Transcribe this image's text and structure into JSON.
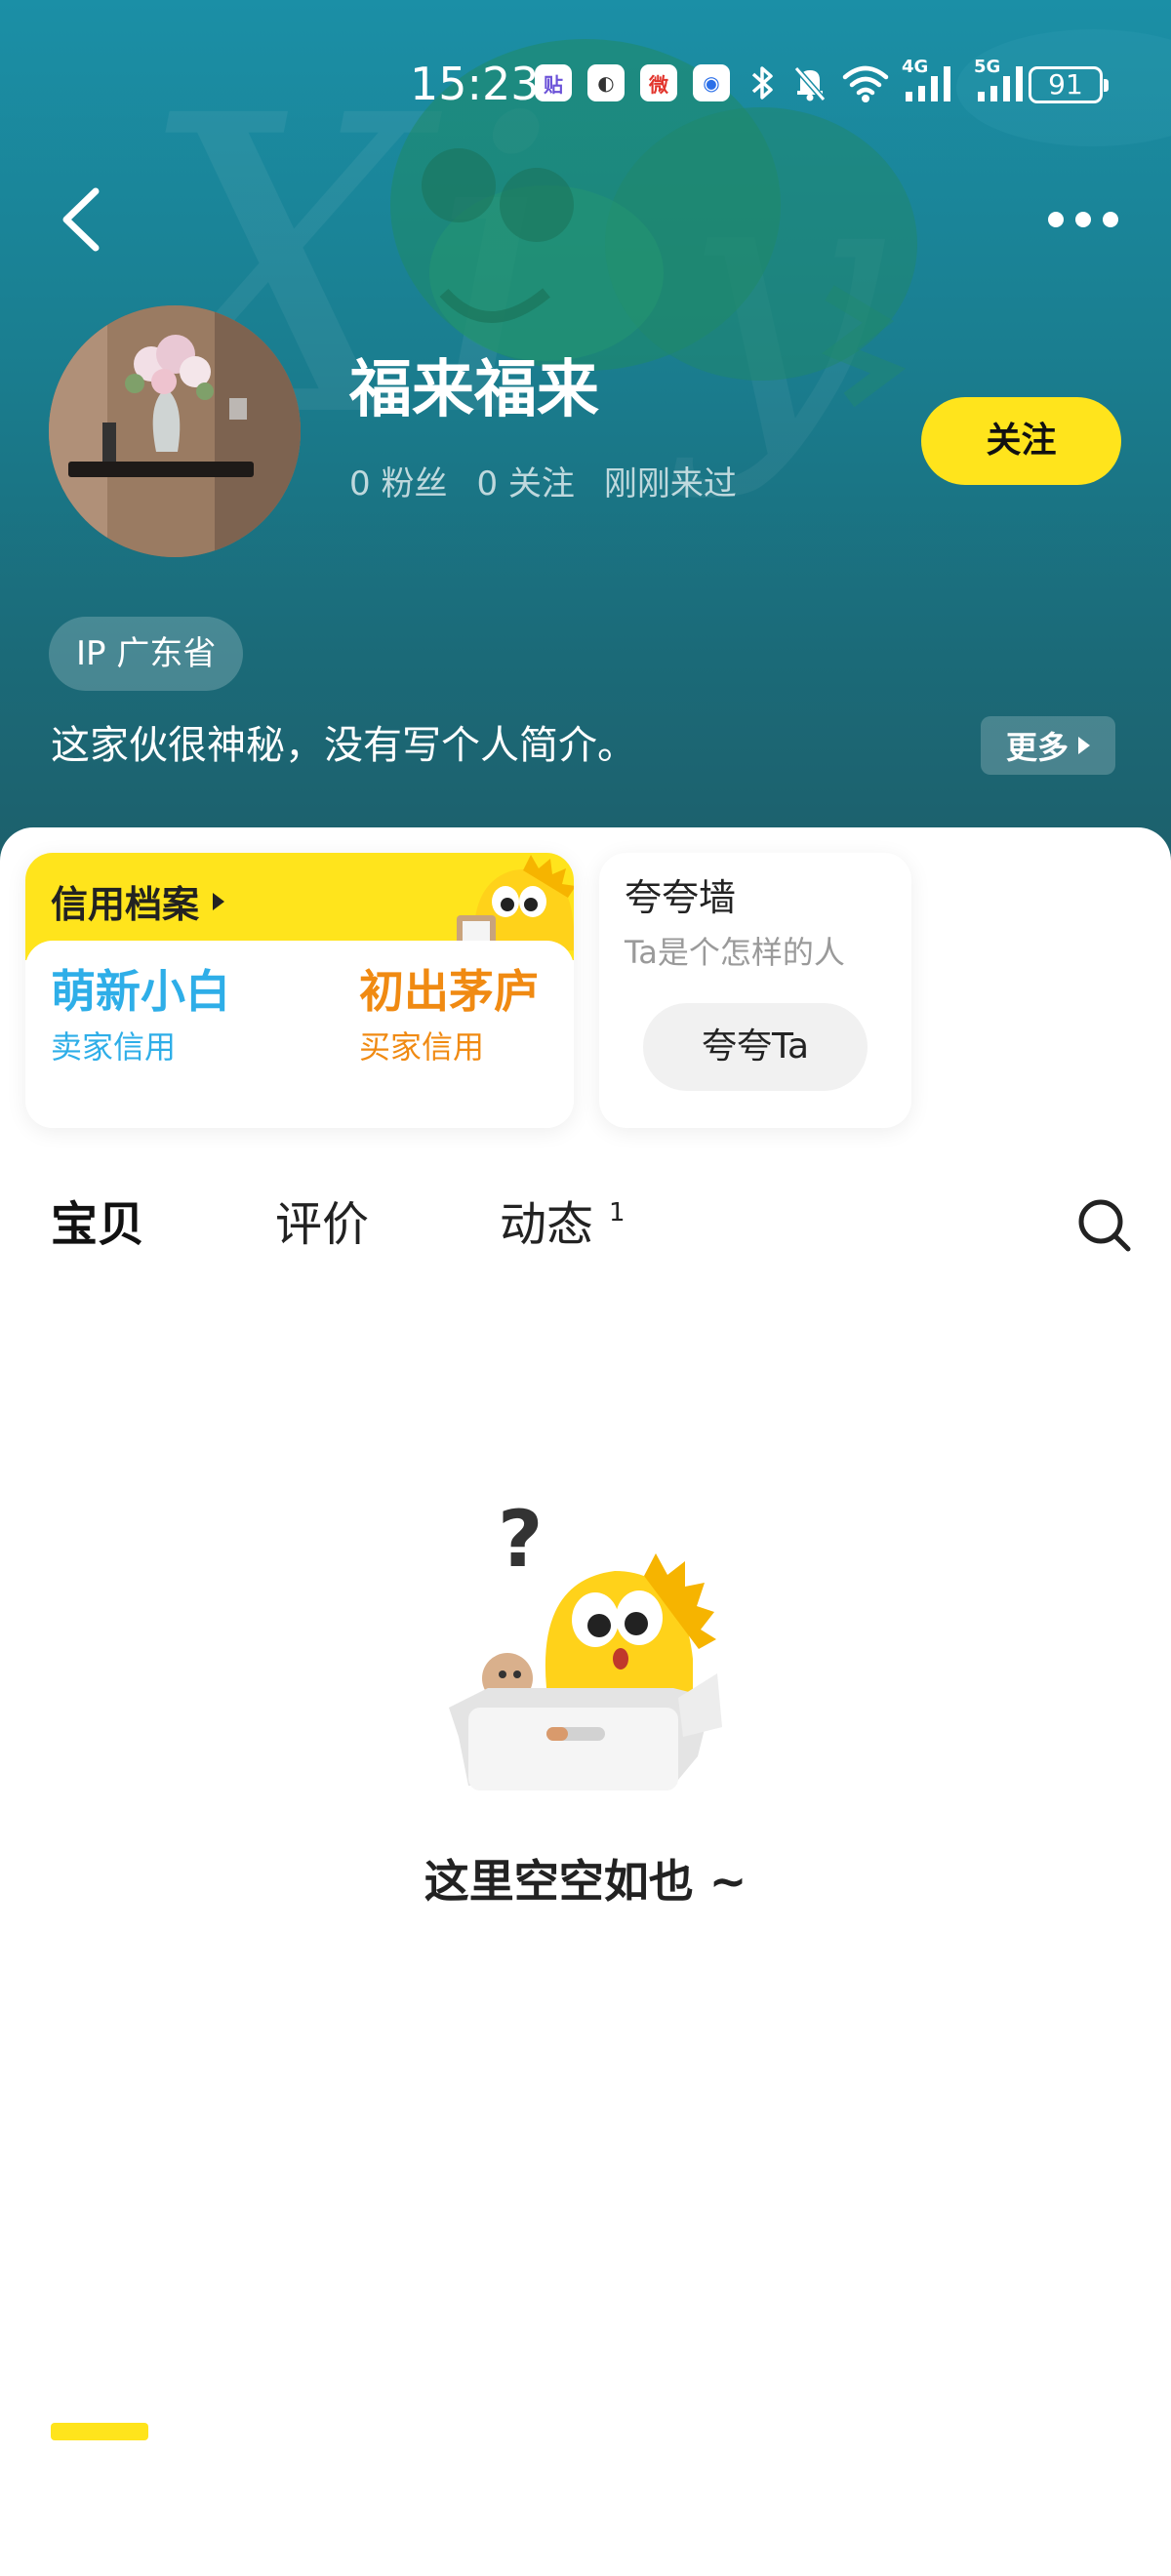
{
  "status_bar": {
    "time": "15:23",
    "apps": [
      "贴",
      "◐",
      "微",
      "◉"
    ],
    "network_4g": "4G",
    "network_5g": "5G",
    "battery": "91"
  },
  "profile": {
    "username": "福来福来",
    "followers": "0 粉丝",
    "following": "0 关注",
    "last_seen": "刚刚来过",
    "follow_label": "关注",
    "ip": "IP 广东省",
    "bio": "这家伙很神秘，没有写个人简介。",
    "more_label": "更多"
  },
  "credit": {
    "title": "信用档案",
    "seller_value": "萌新小白",
    "seller_label": "卖家信用",
    "buyer_value": "初出茅庐",
    "buyer_label": "买家信用",
    "seller_color": "#2eaee8",
    "buyer_color": "#f08a12"
  },
  "praise": {
    "title": "夸夸墙",
    "subtitle": "Ta是个怎样的人",
    "button": "夸夸Ta"
  },
  "tabs": [
    {
      "label": "宝贝",
      "active": true
    },
    {
      "label": "评价",
      "active": false
    },
    {
      "label": "动态",
      "active": false,
      "count": "1"
    }
  ],
  "empty_state": {
    "text": "这里空空如也 ~"
  },
  "colors": {
    "accent_yellow": "#ffe41c",
    "header_teal": "#1b7e90"
  }
}
